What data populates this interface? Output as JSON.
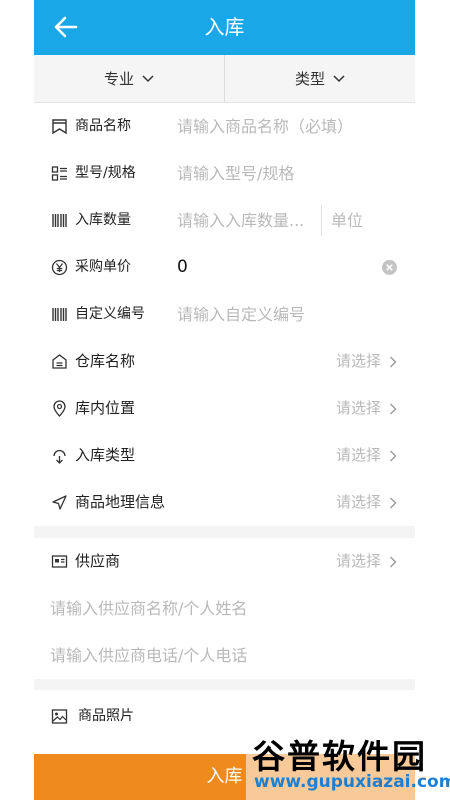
{
  "header": {
    "title": "入库",
    "back_icon": "arrow-left-icon"
  },
  "filters": {
    "major_label": "专业",
    "type_label": "类型"
  },
  "form": {
    "product_name": {
      "label": "商品名称",
      "placeholder": "请输入商品名称（必填）",
      "icon": "bookmark-icon"
    },
    "model": {
      "label": "型号/规格",
      "placeholder": "请输入型号/规格",
      "icon": "list-icon"
    },
    "quantity": {
      "label": "入库数量",
      "placeholder": "请输入入库数量...",
      "unit_placeholder": "单位",
      "icon": "barcode-icon"
    },
    "unit_price": {
      "label": "采购单价",
      "value": "0",
      "icon": "yen-icon"
    },
    "custom_code": {
      "label": "自定义编号",
      "placeholder": "请输入自定义编号",
      "icon": "barcode-icon"
    },
    "warehouse": {
      "label": "仓库名称",
      "select_text": "请选择",
      "icon": "warehouse-icon"
    },
    "location": {
      "label": "库内位置",
      "select_text": "请选择",
      "icon": "location-pin-icon"
    },
    "stock_type": {
      "label": "入库类型",
      "select_text": "请选择",
      "icon": "inbox-icon"
    },
    "geo_info": {
      "label": "商品地理信息",
      "select_text": "请选择",
      "icon": "navigation-icon"
    }
  },
  "supplier": {
    "label": "供应商",
    "select_text": "请选择",
    "icon": "id-card-icon",
    "name_placeholder": "请输入供应商名称/个人姓名",
    "phone_placeholder": "请输入供应商电话/个人电话"
  },
  "photo": {
    "label": "商品照片",
    "icon": "image-icon"
  },
  "footer": {
    "button_label": "入库"
  },
  "watermark": {
    "brand": "谷普软件园",
    "url": "www.gupuxiazai.com"
  },
  "colors": {
    "header_bg": "#1aa7e8",
    "button_bg": "#ef8a1f",
    "placeholder": "#b9b9b9"
  }
}
